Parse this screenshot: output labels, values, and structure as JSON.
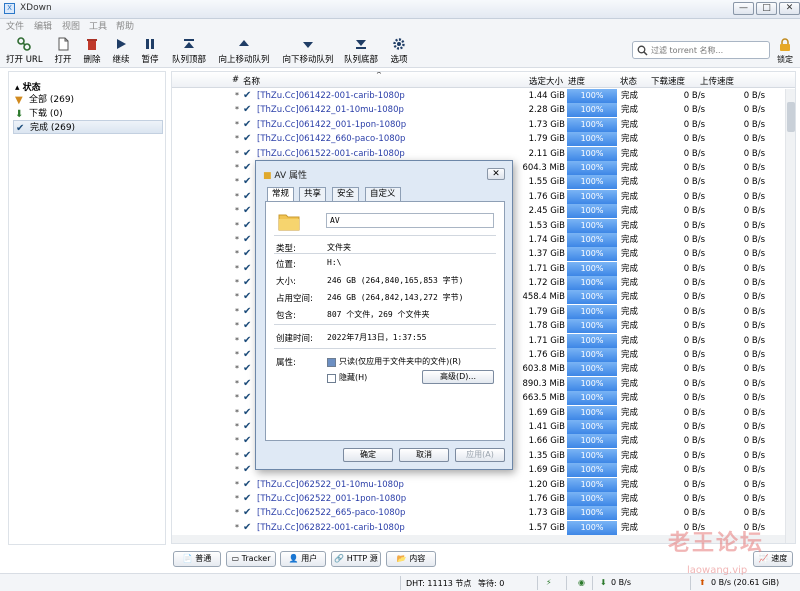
{
  "window": {
    "title": "XDown",
    "controls": [
      "—",
      "□",
      "✕"
    ]
  },
  "menu": [
    "文件",
    "编辑",
    "视图",
    "工具",
    "帮助"
  ],
  "toolbar": {
    "open_url": "打开 URL",
    "open": "打开",
    "delete": "删除",
    "resume": "继续",
    "pause": "暂停",
    "queue_top": "队列顶部",
    "queue_up": "向上移动队列",
    "queue_down": "向下移动队列",
    "queue_bottom": "队列底部",
    "options": "选项"
  },
  "search": {
    "placeholder": "过滤 torrent 名称..."
  },
  "lock_label": "锁定",
  "sidebar": {
    "header": "状态",
    "items": [
      {
        "label": "全部 (269)",
        "icon": "filter-icon"
      },
      {
        "label": "下载 (0)",
        "icon": "download-arrow-icon"
      },
      {
        "label": "完成 (269)",
        "icon": "check-icon"
      }
    ]
  },
  "columns": {
    "num": "#",
    "name": "名称",
    "size": "选定大小",
    "progress": "进度",
    "status": "状态",
    "down": "下载速度",
    "up": "上传速度"
  },
  "rows": [
    {
      "name": "[ThZu.Cc]061422-001-carib-1080p",
      "size": "1.44 GiB"
    },
    {
      "name": "[ThZu.Cc]061422_01-10mu-1080p",
      "size": "2.28 GiB"
    },
    {
      "name": "[ThZu.Cc]061422_001-1pon-1080p",
      "size": "1.73 GiB"
    },
    {
      "name": "[ThZu.Cc]061422_660-paco-1080p",
      "size": "1.79 GiB"
    },
    {
      "name": "[ThZu.Cc]061522-001-carib-1080p",
      "size": "2.11 GiB"
    },
    {
      "name": "",
      "size": "604.3 MiB"
    },
    {
      "name": "",
      "size": "1.55 GiB"
    },
    {
      "name": "",
      "size": "1.76 GiB"
    },
    {
      "name": "",
      "size": "2.45 GiB"
    },
    {
      "name": "",
      "size": "1.53 GiB"
    },
    {
      "name": "",
      "size": "1.74 GiB"
    },
    {
      "name": "",
      "size": "1.37 GiB"
    },
    {
      "name": "",
      "size": "1.71 GiB"
    },
    {
      "name": "",
      "size": "1.72 GiB"
    },
    {
      "name": "",
      "size": "458.4 MiB"
    },
    {
      "name": "",
      "size": "1.79 GiB"
    },
    {
      "name": "",
      "size": "1.78 GiB"
    },
    {
      "name": "",
      "size": "1.71 GiB"
    },
    {
      "name": "",
      "size": "1.76 GiB"
    },
    {
      "name": "",
      "size": "603.8 MiB"
    },
    {
      "name": "",
      "size": "890.3 MiB"
    },
    {
      "name": "",
      "size": "663.5 MiB"
    },
    {
      "name": "",
      "size": "1.69 GiB"
    },
    {
      "name": "",
      "size": "1.41 GiB"
    },
    {
      "name": "",
      "size": "1.66 GiB"
    },
    {
      "name": "",
      "size": "1.35 GiB"
    },
    {
      "name": "",
      "size": "1.69 GiB"
    },
    {
      "name": "[ThZu.Cc]062522_01-10mu-1080p",
      "size": "1.20 GiB"
    },
    {
      "name": "[ThZu.Cc]062522_001-1pon-1080p",
      "size": "1.76 GiB"
    },
    {
      "name": "[ThZu.Cc]062522_665-paco-1080p",
      "size": "1.73 GiB"
    },
    {
      "name": "[ThZu.Cc]062822-001-carib-1080p",
      "size": "1.57 GiB"
    }
  ],
  "row_common": {
    "progress": "100%",
    "status": "完成",
    "down": "0 B/s",
    "up": "0 B/s"
  },
  "bottom_tabs": [
    "普通",
    "Tracker",
    "用户",
    "HTTP 源",
    "内容"
  ],
  "speed_btn": "速度",
  "statusbar": {
    "dht": "DHT: 11113 节点",
    "waiting": "等待: 0",
    "down": "0 B/s",
    "up": "0 B/s (20.61 GiB)"
  },
  "dialog": {
    "title": "AV 属性",
    "tabs": [
      "常规",
      "共享",
      "安全",
      "自定义"
    ],
    "name": "AV",
    "type_k": "类型:",
    "type_v": "文件夹",
    "loc_k": "位置:",
    "loc_v": "H:\\",
    "size_k": "大小:",
    "size_v": "246 GB (264,840,165,853 字节)",
    "disk_k": "占用空间:",
    "disk_v": "246 GB (264,842,143,272 字节)",
    "contains_k": "包含:",
    "contains_v": "807 个文件，269 个文件夹",
    "created_k": "创建时间:",
    "created_v": "2022年7月13日，1:37:55",
    "attr_k": "属性:",
    "readonly": "只读(仅应用于文件夹中的文件)(R)",
    "hidden": "隐藏(H)",
    "advanced": "高级(D)...",
    "ok": "确定",
    "cancel": "取消",
    "apply": "应用(A)"
  },
  "watermark": {
    "line1": "老王论坛",
    "line2": "laowang.vip"
  }
}
